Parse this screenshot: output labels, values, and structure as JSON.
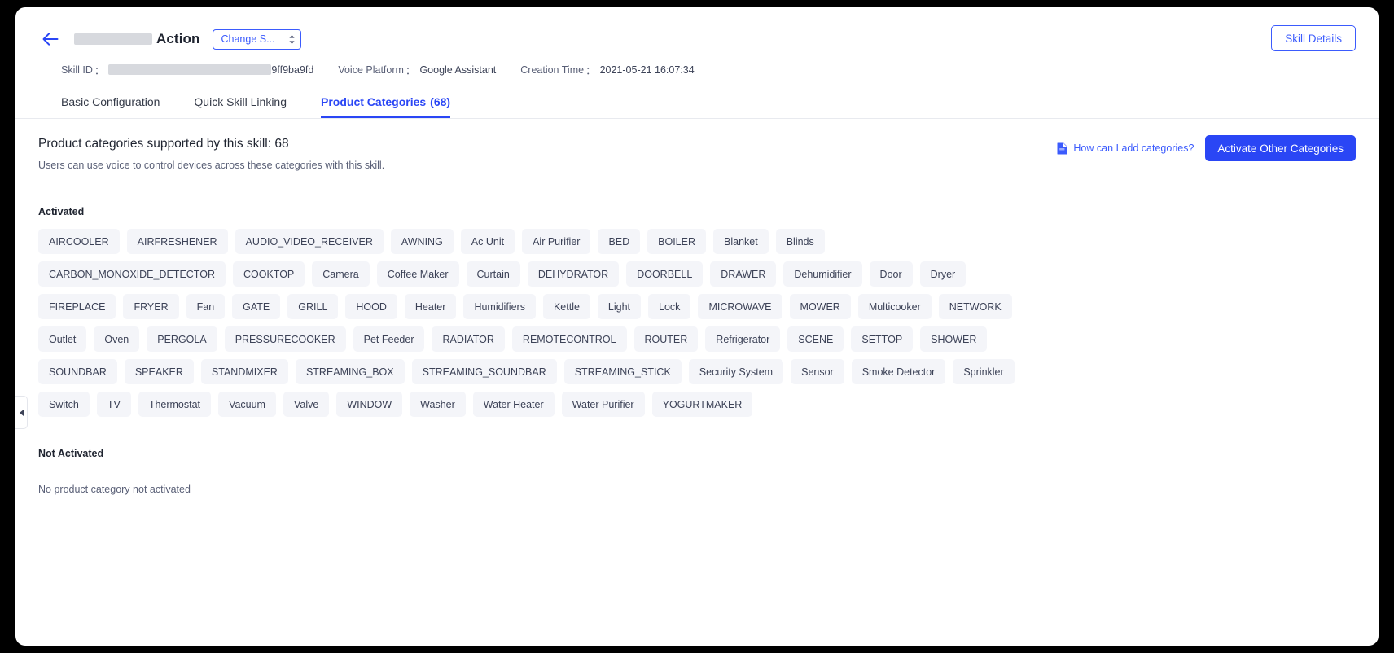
{
  "header": {
    "back_icon": "back-arrow-icon",
    "title_suffix": "Action",
    "title_redacted": true,
    "change_skill_label": "Change S...",
    "change_skill_caret": "⇅",
    "skill_details_label": "Skill Details",
    "meta": {
      "skill_id_label": "Skill ID",
      "skill_id_value": "9ff9ba9fd",
      "voice_platform_label": "Voice Platform",
      "voice_platform_value": "Google Assistant",
      "creation_time_label": "Creation Time",
      "creation_time_value": "2021-05-21 16:07:34",
      "separator": "："
    },
    "tabs": [
      {
        "label": "Basic Configuration",
        "count": "",
        "active": false
      },
      {
        "label": "Quick Skill Linking",
        "count": "",
        "active": false
      },
      {
        "label": "Product Categories",
        "count": "(68)",
        "active": true
      }
    ]
  },
  "main": {
    "section_title": "Product categories supported by this skill: 68",
    "section_subtitle": "Users can use voice to control devices across these categories with this skill.",
    "how_link_label": "How can I add categories?",
    "how_link_icon": "document-icon",
    "activate_button_label": "Activate Other Categories",
    "activated_label": "Activated",
    "not_activated_label": "Not Activated",
    "not_activated_empty": "No product category not activated",
    "activated_categories": [
      "AIRCOOLER",
      "AIRFRESHENER",
      "AUDIO_VIDEO_RECEIVER",
      "AWNING",
      "Ac Unit",
      "Air Purifier",
      "BED",
      "BOILER",
      "Blanket",
      "Blinds",
      "CARBON_MONOXIDE_DETECTOR",
      "COOKTOP",
      "Camera",
      "Coffee Maker",
      "Curtain",
      "DEHYDRATOR",
      "DOORBELL",
      "DRAWER",
      "Dehumidifier",
      "Door",
      "Dryer",
      "FIREPLACE",
      "FRYER",
      "Fan",
      "GATE",
      "GRILL",
      "HOOD",
      "Heater",
      "Humidifiers",
      "Kettle",
      "Light",
      "Lock",
      "MICROWAVE",
      "MOWER",
      "Multicooker",
      "NETWORK",
      "Outlet",
      "Oven",
      "PERGOLA",
      "PRESSURECOOKER",
      "Pet Feeder",
      "RADIATOR",
      "REMOTECONTROL",
      "ROUTER",
      "Refrigerator",
      "SCENE",
      "SETTOP",
      "SHOWER",
      "SOUNDBAR",
      "SPEAKER",
      "STANDMIXER",
      "STREAMING_BOX",
      "STREAMING_SOUNDBAR",
      "STREAMING_STICK",
      "Security System",
      "Sensor",
      "Smoke Detector",
      "Sprinkler",
      "Switch",
      "TV",
      "Thermostat",
      "Vacuum",
      "Valve",
      "WINDOW",
      "Washer",
      "Water Heater",
      "Water Purifier",
      "YOGURTMAKER"
    ],
    "not_activated_categories": []
  },
  "sidebar": {
    "collapse_handle_icon": "chevron-left-icon"
  },
  "colors": {
    "accent": "#2a46f5",
    "link": "#3b5bfd",
    "chip_bg": "#f4f5f9",
    "text": "#3c4257",
    "page_bg": "#ffffff",
    "outer_bg": "#000000"
  }
}
